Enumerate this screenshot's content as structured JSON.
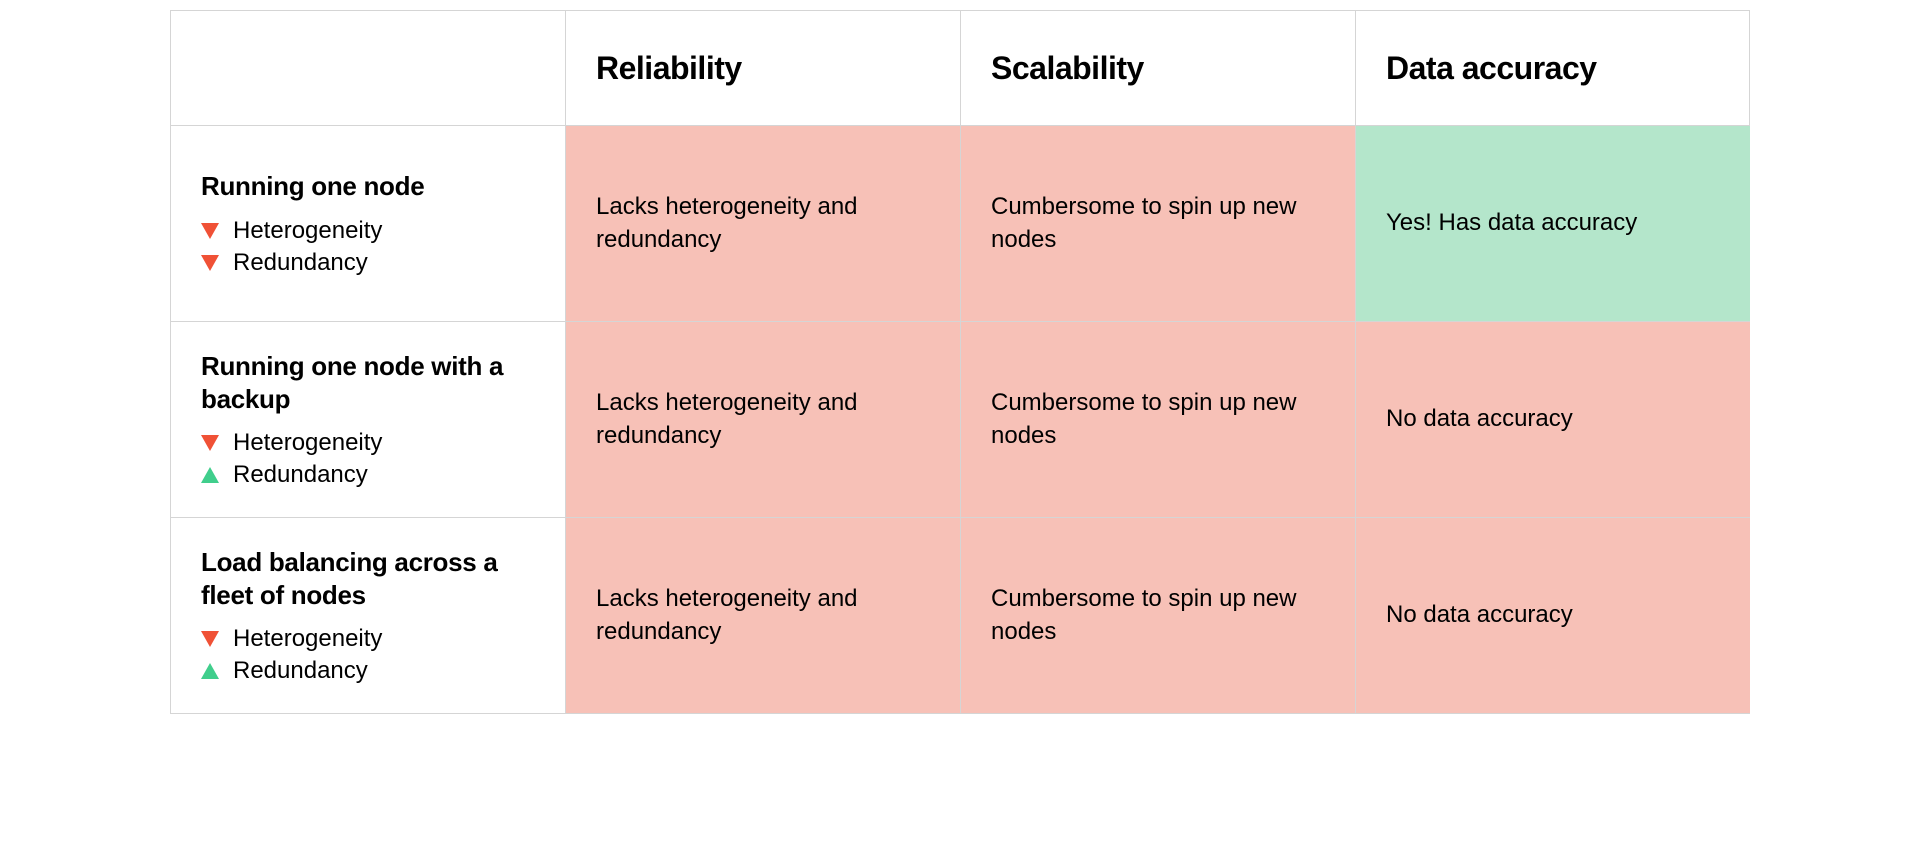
{
  "colors": {
    "bad_bg": "#f7c1b7",
    "good_bg": "#b4e6cb",
    "tri_down": "#f05136",
    "tri_up": "#40ce8c"
  },
  "columns": [
    {
      "label": "Reliability"
    },
    {
      "label": "Scalability"
    },
    {
      "label": "Data accuracy"
    }
  ],
  "rows": [
    {
      "title": "Running one node",
      "tags": [
        {
          "direction": "down",
          "label": "Heterogeneity"
        },
        {
          "direction": "down",
          "label": "Redundancy"
        }
      ],
      "cells": [
        {
          "status": "bad",
          "text": "Lacks heterogeneity and redundancy"
        },
        {
          "status": "bad",
          "text": "Cumbersome to spin up new nodes"
        },
        {
          "status": "good",
          "text": "Yes! Has data accuracy"
        }
      ]
    },
    {
      "title": "Running one node with a backup",
      "tags": [
        {
          "direction": "down",
          "label": "Heterogeneity"
        },
        {
          "direction": "up",
          "label": "Redundancy"
        }
      ],
      "cells": [
        {
          "status": "bad",
          "text": "Lacks heterogeneity and redundancy"
        },
        {
          "status": "bad",
          "text": "Cumbersome to spin up new nodes"
        },
        {
          "status": "bad",
          "text": "No data accuracy"
        }
      ]
    },
    {
      "title": "Load balancing across a fleet of nodes",
      "tags": [
        {
          "direction": "down",
          "label": "Heterogeneity"
        },
        {
          "direction": "up",
          "label": "Redundancy"
        }
      ],
      "cells": [
        {
          "status": "bad",
          "text": "Lacks heterogeneity and redundancy"
        },
        {
          "status": "bad",
          "text": "Cumbersome to spin up new nodes"
        },
        {
          "status": "bad",
          "text": "No data accuracy"
        }
      ]
    }
  ]
}
